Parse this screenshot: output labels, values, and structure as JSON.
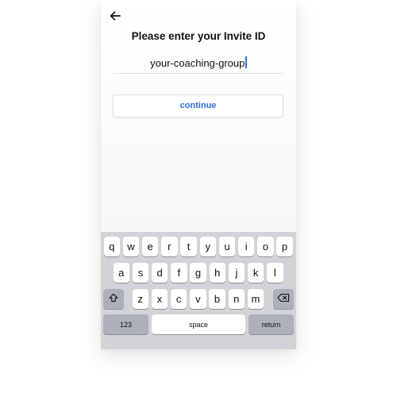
{
  "header": {
    "title": "Please enter your Invite ID",
    "back_icon": "arrow-left-icon"
  },
  "invite_input": {
    "value": "your-coaching-group"
  },
  "continue_button": {
    "label": "continue",
    "color": "#2f6fdb"
  },
  "keyboard": {
    "row1": [
      "q",
      "w",
      "e",
      "r",
      "t",
      "y",
      "u",
      "i",
      "o",
      "p"
    ],
    "row2": [
      "a",
      "s",
      "d",
      "f",
      "g",
      "h",
      "j",
      "k",
      "l"
    ],
    "row3": [
      "z",
      "x",
      "c",
      "v",
      "b",
      "n",
      "m"
    ],
    "shift_icon": "shift-icon",
    "backspace_icon": "backspace-icon",
    "numbers_label": "123",
    "space_label": "space",
    "return_label": "return"
  }
}
